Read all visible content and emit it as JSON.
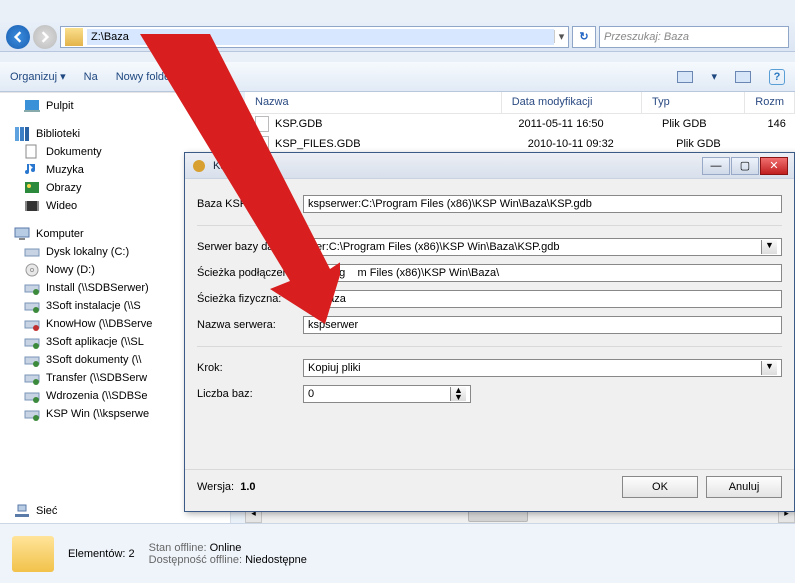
{
  "nav": {
    "address": "Z:\\Baza",
    "searchPlaceholder": "Przeszukaj: Baza"
  },
  "cmd": {
    "organize": "Organizuj",
    "include": "Na",
    "newFolder": "Nowy folder"
  },
  "tree": {
    "desktop": "Pulpit",
    "libraries": "Biblioteki",
    "lib": {
      "docs": "Dokumenty",
      "music": "Muzyka",
      "pics": "Obrazy",
      "video": "Wideo"
    },
    "computer": "Komputer",
    "drives": [
      "Dysk lokalny (C:)",
      "Nowy (D:)",
      "Install (\\\\SDBSerwer)",
      "3Soft instalacje (\\\\S",
      "KnowHow (\\\\DBServe",
      "3Soft aplikacje (\\\\SL",
      "3Soft dokumenty (\\\\",
      "Transfer (\\\\SDBSerw",
      "Wdrozenia (\\\\SDBSe",
      "KSP Win (\\\\kspserwe"
    ],
    "network": "Sieć"
  },
  "cols": {
    "name": "Nazwa",
    "date": "Data modyfikacji",
    "type": "Typ",
    "size": "Rozm"
  },
  "files": [
    {
      "name": "KSP.GDB",
      "date": "2011-05-11 16:50",
      "type": "Plik GDB",
      "size": "146"
    },
    {
      "name": "KSP_FILES.GDB",
      "date": "2010-10-11 09:32",
      "type": "Plik GDB",
      "size": ""
    }
  ],
  "dlg": {
    "title": "Ksp L",
    "labels": {
      "baza": "Baza KSP:",
      "server": "Serwer bazy danych:",
      "connPath": "Ścieżka podłączenia:",
      "physPath": "Ścieżka fizyczna:",
      "srvName": "Nazwa serwera:",
      "step": "Krok:",
      "count": "Liczba baz:",
      "version": "Wersja:"
    },
    "values": {
      "baza": "kspserwer:C:\\Program Files (x86)\\KSP Win\\Baza\\KSP.gdb",
      "server": "wer:C:\\Program Files (x86)\\KSP Win\\Baza\\KSP.gdb",
      "connPath": "C:\\Prog    m Files (x86)\\KSP Win\\Baza\\",
      "physPath": "Z:\\Baza",
      "srvName": "kspserwer",
      "step": "Kopiuj pliki",
      "count": "0",
      "version": "1.0",
      "ok": "OK",
      "cancel": "Anuluj"
    }
  },
  "details": {
    "count": "Elementów: 2",
    "l1": "Stan offline:",
    "v1": "Online",
    "l2": "Dostępność offline:",
    "v2": "Niedostępne"
  }
}
